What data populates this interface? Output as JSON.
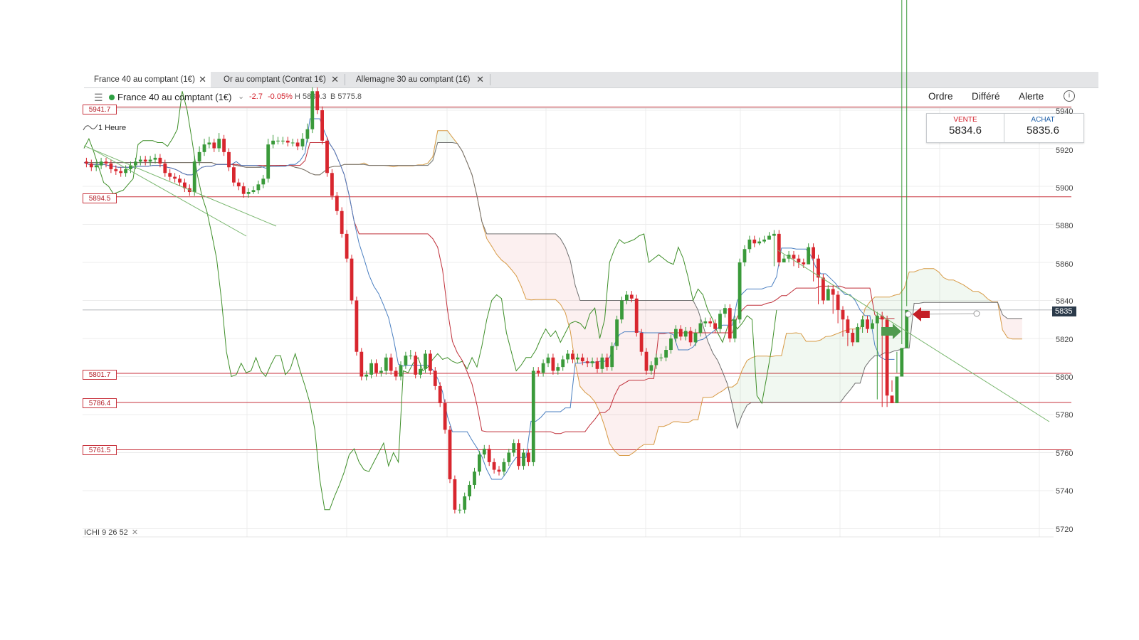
{
  "tabs": [
    {
      "label": "France 40 au comptant (1€)",
      "active": true
    },
    {
      "label": "Or au comptant (Contrat 1€)",
      "active": false
    },
    {
      "label": "Allemagne 30 au comptant (1€)",
      "active": false
    }
  ],
  "tab_close_glyph": "✕",
  "toolbar": {
    "instrument": "France 40 au comptant (1€)",
    "change": "-2.7",
    "change_pct": "-0.05%",
    "high": "H 5839.3",
    "low": "B 5775.8",
    "menu": [
      "Ordre",
      "Différé",
      "Alerte"
    ],
    "menu_icon": "hamburger-icon",
    "status_color": "#2ea043"
  },
  "timeframe": "1 Heure",
  "trade": {
    "sell_label": "VENTE",
    "sell_price": "5834.6",
    "buy_label": "ACHAT",
    "buy_price": "5835.6",
    "sell_color": "#d21f2a",
    "buy_color": "#1e5fa8"
  },
  "level_labels": [
    "5941.7",
    "5894.5",
    "5801.7",
    "5786.4",
    "5761.5"
  ],
  "y_tick_labels": [
    "5940",
    "5920",
    "5900",
    "5880",
    "5860",
    "5840",
    "5820",
    "5800",
    "5780",
    "5760",
    "5740",
    "5720"
  ],
  "current_price_tag": "5835",
  "indicator": {
    "name": "ICHI",
    "p1": "9",
    "p2": "26",
    "p3": "52",
    "close": "✕"
  },
  "colors": {
    "bull": "#3a9a3a",
    "bear": "#d8262e",
    "tenkan": "#4a7fc1",
    "kijun": "#c0303a",
    "chikou": "#3f8f2a",
    "senkou_a": "#d79a45",
    "senkou_b": "#707070",
    "level": "#c8323c",
    "buy_arrow": "#4f9a4f",
    "sell_arrow": "#c41f26"
  },
  "chart_data": {
    "type": "candlestick",
    "interval": "1 Heure",
    "ylim": [
      5715,
      5945
    ],
    "y_ticks": [
      5940,
      5920,
      5900,
      5880,
      5860,
      5840,
      5820,
      5800,
      5780,
      5760,
      5740,
      5720
    ],
    "horizontal_levels": [
      5941.7,
      5894.5,
      5801.7,
      5786.4,
      5761.5
    ],
    "last_price": 5835,
    "ohlc_count": 168,
    "ohlc_open": [
      5913,
      5912,
      5910,
      5911,
      5913,
      5912,
      5909,
      5908,
      5907,
      5909,
      5911,
      5913,
      5914,
      5913,
      5914,
      5915,
      5912,
      5907,
      5905,
      5904,
      5902,
      5899,
      5897,
      5913,
      5918,
      5922,
      5923,
      5920,
      5925,
      5918,
      5910,
      5902,
      5900,
      5896,
      5897,
      5898,
      5901,
      5904,
      5922,
      5924,
      5924,
      5924,
      5923,
      5923,
      5921,
      5925,
      5930,
      5950,
      5940,
      5924,
      5907,
      5895,
      5887,
      5875,
      5862,
      5840,
      5813,
      5800,
      5801,
      5807,
      5802,
      5803,
      5810,
      5803,
      5800,
      5806,
      5811,
      5811,
      5801,
      5804,
      5812,
      5803,
      5795,
      5786,
      5772,
      5746,
      5730,
      5730,
      5737,
      5743,
      5750,
      5759,
      5762,
      5755,
      5751,
      5750,
      5755,
      5760,
      5765,
      5753,
      5760,
      5755,
      5803,
      5802,
      5807,
      5810,
      5803,
      5805,
      5809,
      5812,
      5809,
      5810,
      5808,
      5807,
      5808,
      5804,
      5810,
      5805,
      5816,
      5830,
      5840,
      5843,
      5841,
      5823,
      5813,
      5803,
      5806,
      5810,
      5810,
      5814,
      5820,
      5825,
      5821,
      5824,
      5818,
      5823,
      5828,
      5829,
      5828,
      5825,
      5833,
      5836,
      5820,
      5830,
      5860,
      5867,
      5872,
      5870,
      5871,
      5872,
      5874,
      5875,
      5860,
      5862,
      5864,
      5862,
      5860,
      5859,
      5868,
      5862,
      5852,
      5840,
      5846,
      5843,
      5835,
      5830,
      5823,
      5818,
      5826,
      5830,
      5825,
      5828,
      5832,
      5830,
      5790,
      5786,
      5800,
      5815
    ],
    "ohlc_close": [
      5912,
      5910,
      5911,
      5913,
      5912,
      5909,
      5908,
      5907,
      5909,
      5911,
      5913,
      5914,
      5913,
      5914,
      5915,
      5912,
      5907,
      5905,
      5904,
      5902,
      5899,
      5897,
      5913,
      5918,
      5922,
      5923,
      5920,
      5925,
      5918,
      5910,
      5902,
      5900,
      5896,
      5897,
      5898,
      5901,
      5904,
      5922,
      5924,
      5924,
      5924,
      5923,
      5923,
      5921,
      5925,
      5930,
      5950,
      5940,
      5924,
      5907,
      5895,
      5887,
      5875,
      5862,
      5840,
      5813,
      5800,
      5801,
      5807,
      5802,
      5803,
      5810,
      5803,
      5800,
      5806,
      5811,
      5811,
      5801,
      5804,
      5812,
      5803,
      5795,
      5786,
      5772,
      5746,
      5730,
      5730,
      5737,
      5743,
      5750,
      5759,
      5762,
      5755,
      5751,
      5750,
      5755,
      5760,
      5765,
      5753,
      5760,
      5755,
      5803,
      5802,
      5807,
      5810,
      5803,
      5805,
      5809,
      5812,
      5809,
      5810,
      5808,
      5807,
      5808,
      5804,
      5810,
      5805,
      5816,
      5830,
      5840,
      5843,
      5841,
      5823,
      5813,
      5803,
      5806,
      5810,
      5810,
      5814,
      5820,
      5825,
      5821,
      5824,
      5818,
      5823,
      5828,
      5829,
      5828,
      5825,
      5833,
      5836,
      5820,
      5830,
      5860,
      5867,
      5872,
      5870,
      5871,
      5872,
      5874,
      5875,
      5860,
      5862,
      5864,
      5862,
      5860,
      5859,
      5868,
      5862,
      5852,
      5840,
      5846,
      5843,
      5835,
      5830,
      5823,
      5818,
      5826,
      5830,
      5825,
      5828,
      5832,
      5830,
      5790,
      5786,
      5800,
      5815,
      5835
    ],
    "ohlc_high": [
      5915,
      5914,
      5913,
      5915,
      5915,
      5914,
      5911,
      5910,
      5911,
      5913,
      5915,
      5916,
      5916,
      5916,
      5917,
      5917,
      5914,
      5909,
      5907,
      5906,
      5904,
      5901,
      5916,
      5921,
      5925,
      5926,
      5925,
      5928,
      5927,
      5920,
      5912,
      5904,
      5902,
      5899,
      5900,
      5903,
      5906,
      5925,
      5927,
      5926,
      5926,
      5926,
      5925,
      5925,
      5928,
      5933,
      5952,
      5952,
      5942,
      5926,
      5909,
      5897,
      5889,
      5877,
      5864,
      5842,
      5815,
      5803,
      5809,
      5809,
      5805,
      5812,
      5812,
      5805,
      5808,
      5813,
      5814,
      5813,
      5806,
      5814,
      5814,
      5805,
      5797,
      5788,
      5774,
      5748,
      5733,
      5739,
      5745,
      5752,
      5761,
      5764,
      5764,
      5757,
      5753,
      5757,
      5762,
      5767,
      5767,
      5762,
      5762,
      5805,
      5805,
      5809,
      5812,
      5812,
      5807,
      5811,
      5814,
      5814,
      5812,
      5812,
      5810,
      5810,
      5810,
      5812,
      5812,
      5818,
      5832,
      5842,
      5845,
      5845,
      5843,
      5825,
      5815,
      5808,
      5812,
      5812,
      5816,
      5822,
      5827,
      5827,
      5826,
      5826,
      5825,
      5830,
      5831,
      5831,
      5830,
      5835,
      5838,
      5838,
      5832,
      5862,
      5869,
      5874,
      5874,
      5873,
      5874,
      5876,
      5877,
      5877,
      5864,
      5866,
      5866,
      5864,
      5862,
      5870,
      5870,
      5864,
      5854,
      5848,
      5848,
      5845,
      5837,
      5832,
      5825,
      5828,
      5832,
      5832,
      5830,
      5834,
      5834,
      5832,
      5792,
      5802,
      5817,
      5837
    ],
    "ohlc_low": [
      5910,
      5908,
      5908,
      5909,
      5910,
      5907,
      5906,
      5905,
      5905,
      5907,
      5909,
      5911,
      5911,
      5911,
      5912,
      5910,
      5905,
      5903,
      5902,
      5900,
      5897,
      5895,
      5895,
      5911,
      5916,
      5920,
      5918,
      5918,
      5916,
      5908,
      5900,
      5898,
      5894,
      5894,
      5896,
      5896,
      5899,
      5902,
      5920,
      5922,
      5922,
      5921,
      5921,
      5919,
      5919,
      5923,
      5928,
      5938,
      5922,
      5905,
      5893,
      5885,
      5873,
      5860,
      5838,
      5811,
      5798,
      5798,
      5799,
      5800,
      5800,
      5801,
      5801,
      5798,
      5798,
      5804,
      5809,
      5799,
      5799,
      5802,
      5801,
      5793,
      5784,
      5770,
      5744,
      5728,
      5728,
      5728,
      5735,
      5741,
      5748,
      5757,
      5753,
      5749,
      5748,
      5748,
      5753,
      5758,
      5751,
      5751,
      5753,
      5753,
      5800,
      5800,
      5805,
      5801,
      5801,
      5803,
      5807,
      5807,
      5807,
      5806,
      5805,
      5805,
      5802,
      5802,
      5803,
      5803,
      5814,
      5828,
      5838,
      5839,
      5821,
      5811,
      5801,
      5801,
      5804,
      5808,
      5808,
      5812,
      5818,
      5819,
      5819,
      5816,
      5816,
      5821,
      5826,
      5826,
      5823,
      5823,
      5831,
      5818,
      5818,
      5828,
      5858,
      5865,
      5868,
      5869,
      5870,
      5872,
      5858,
      5858,
      5860,
      5860,
      5858,
      5857,
      5857,
      5860,
      5850,
      5838,
      5838,
      5841,
      5833,
      5828,
      5821,
      5816,
      5816,
      5823,
      5823,
      5823,
      5826,
      5788,
      5784,
      5784,
      5798,
      5813
    ],
    "ichimoku_params": [
      9,
      26,
      52
    ]
  }
}
